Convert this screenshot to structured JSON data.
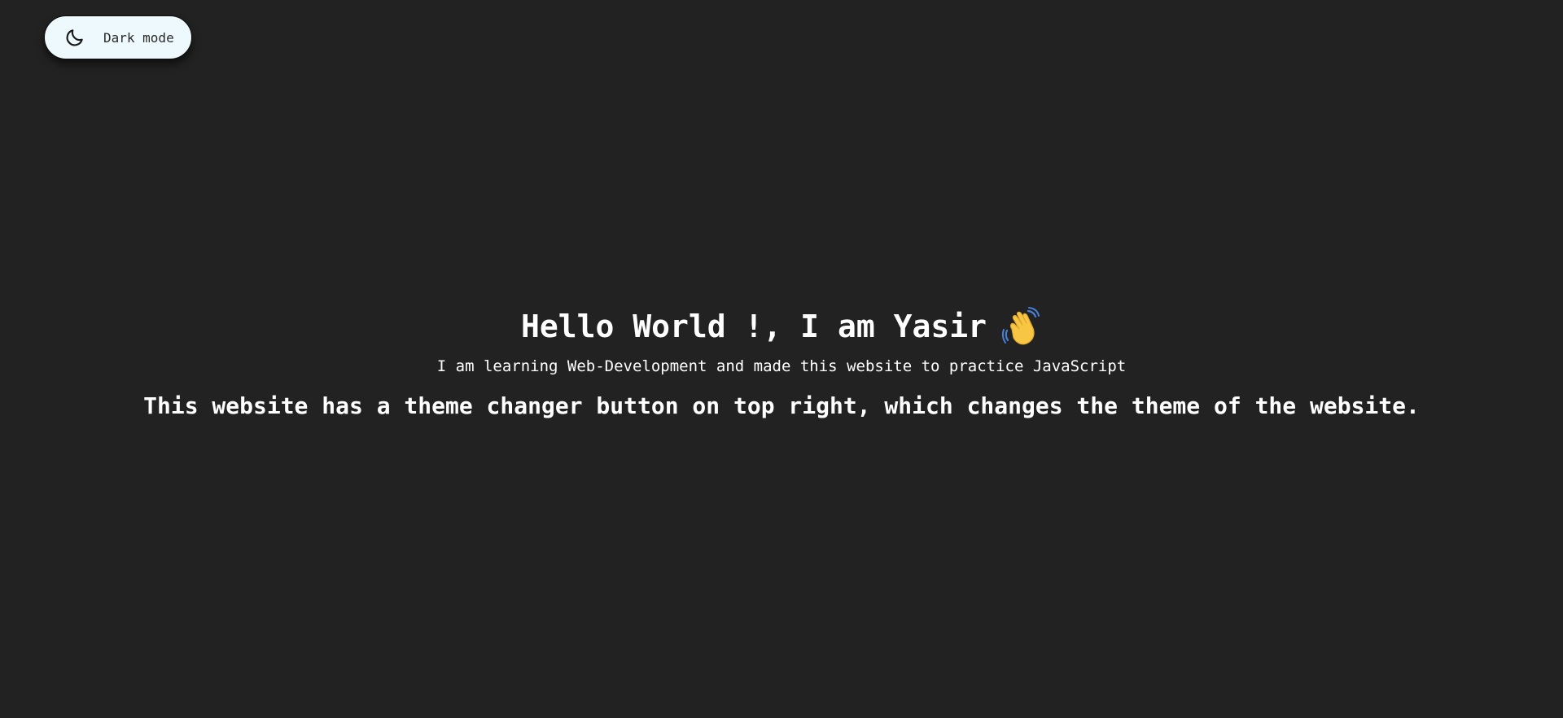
{
  "theme_toggle": {
    "label": "Dark mode",
    "icon": "moon-icon"
  },
  "hero": {
    "title": "Hello World !, I am Yasir",
    "title_icon": "waving-hand-icon",
    "subtitle": "I am learning Web-Development and made this website to practice JavaScript",
    "description": "This website has a theme changer button on top right, which changes the theme of the website."
  },
  "colors": {
    "background": "#222222",
    "text": "#ffffff",
    "toggle_background": "#eef9fd",
    "hand": "#f7c744"
  }
}
